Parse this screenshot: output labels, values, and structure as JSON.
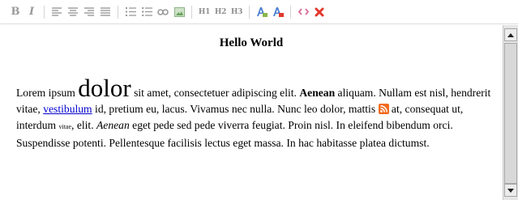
{
  "toolbar": {
    "bold": "B",
    "italic": "I",
    "h1": "H1",
    "h2": "H2",
    "h3": "H3",
    "icons": [
      "bold-icon",
      "italic-icon",
      "align-left-icon",
      "align-center-icon",
      "align-right-icon",
      "align-justify-icon",
      "ordered-list-icon",
      "unordered-list-icon",
      "link-icon",
      "image-icon",
      "h1-icon",
      "h2-icon",
      "h3-icon",
      "text-color-icon",
      "clear-format-icon",
      "source-code-icon",
      "remove-format-icon"
    ],
    "colors": {
      "accent_blue": "#4a7fd0",
      "accent_red": "#e2382b",
      "muted": "#9a9a9a"
    }
  },
  "editor": {
    "heading": "Hello World",
    "para": {
      "t1": "Lorem ipsum ",
      "big": "dolor",
      "t2": " sit amet, consectetuer adipiscing elit. ",
      "bold": "Aenean",
      "t3": " aliquam. Nullam est nisl, hendrerit vitae, ",
      "link": "vestibulum",
      "t4": " id, pretium eu, lacus. Vivamus nec nulla. Nunc leo dolor, mattis ",
      "t5": " at, consequat ut, interdum ",
      "tiny": "vitae",
      "t6": ", elit. ",
      "italic": "Aenean",
      "t7": " eget pede sed pede viverra feugiat. Proin nisl. In eleifend bibendum orci. Suspendisse potenti. Pellentesque facilisis lectus eget massa. In hac habitasse platea dictumst."
    },
    "inline_icon": "rss-icon"
  }
}
